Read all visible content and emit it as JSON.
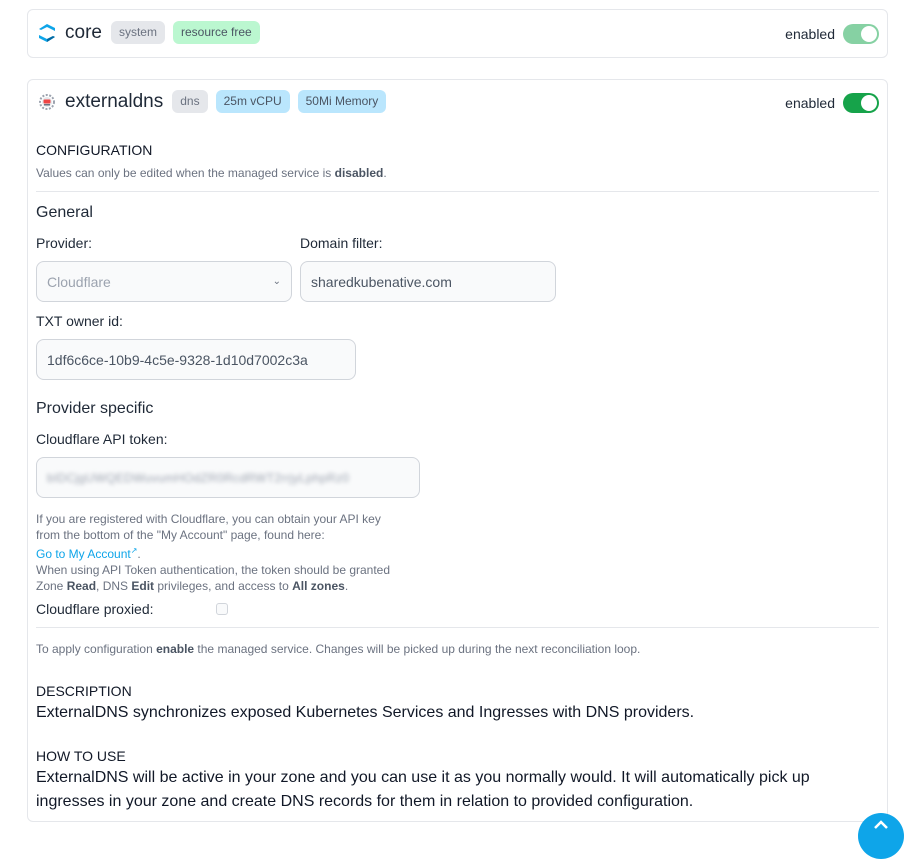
{
  "core": {
    "title": "core",
    "badges": [
      "system",
      "resource free"
    ],
    "toggle_label": "enabled",
    "enabled": true
  },
  "externaldns": {
    "title": "externaldns",
    "badges": [
      "dns",
      "25m vCPU",
      "50Mi Memory"
    ],
    "toggle_label": "enabled",
    "enabled": true,
    "configuration": {
      "heading": "CONFIGURATION",
      "note_prefix": "Values can only be edited when the managed service is ",
      "note_bold": "disabled",
      "note_suffix": ".",
      "general_heading": "General",
      "provider_label": "Provider:",
      "provider_value": "Cloudflare",
      "domain_filter_label": "Domain filter:",
      "domain_filter_value": "sharedkubenative.com",
      "txt_owner_label": "TXT owner id:",
      "txt_owner_value": "1df6c6ce-10b9-4c5e-9328-1d10d7002c3a",
      "provider_specific_heading": "Provider specific",
      "api_token_label": "Cloudflare API token:",
      "api_token_value": "bIDCjgUWQEDWuvumHOdZR0RcdRWT2rrjyLphpRz0",
      "help_line1": "If you are registered with Cloudflare, you can obtain your API key",
      "help_line2": "from the bottom of the \"My Account\" page, found here:",
      "help_link": "Go to My Account",
      "help_line4": "When using API Token authentication, the token should be granted",
      "help_l5_a": "Zone ",
      "help_l5_b": "Read",
      "help_l5_c": ", DNS ",
      "help_l5_d": "Edit",
      "help_l5_e": " privileges, and access to ",
      "help_l5_f": "All zones",
      "help_l5_g": ".",
      "proxied_label": "Cloudflare proxied:",
      "proxied_checked": false,
      "apply_prefix": "To apply configuration ",
      "apply_bold": "enable",
      "apply_suffix": " the managed service. Changes will be picked up during the next reconciliation loop."
    },
    "description": {
      "heading": "DESCRIPTION",
      "text": "ExternalDNS synchronizes exposed Kubernetes Services and Ingresses with DNS providers."
    },
    "how_to_use": {
      "heading": "HOW TO USE",
      "text": "ExternalDNS will be active in your zone and you can use it as you normally would. It will automatically pick up ingresses in your zone and create DNS records for them in relation to provided configuration."
    }
  },
  "colors": {
    "toggle_core": "#86d1a3",
    "toggle_ext": "#16a34a",
    "link": "#0ea5e9",
    "fab": "#0ea5e9"
  }
}
